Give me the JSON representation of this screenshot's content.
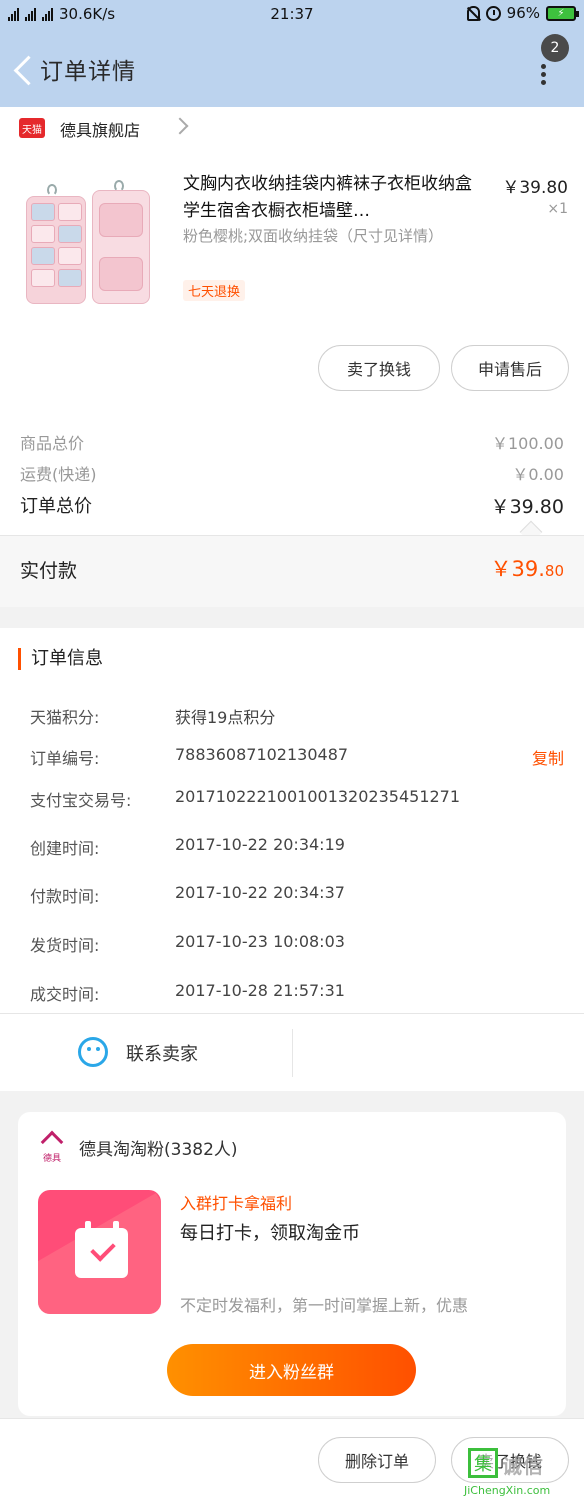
{
  "status_bar": {
    "signal_left": "2G",
    "signal_right": "4G 4G",
    "speed": "30.6K/s",
    "time": "21:37",
    "battery": "96%"
  },
  "nav": {
    "title": "订单详情",
    "message_count": "2"
  },
  "shop": {
    "badge": "天猫",
    "name": "德具旗舰店"
  },
  "product": {
    "title": "文胸内衣收纳挂袋内裤袜子衣柜收纳盒学生宿舍衣橱衣柜墙壁…",
    "price": "￥39.80",
    "qty": "×1",
    "spec": "粉色樱桃;双面收纳挂袋（尺寸见详情）",
    "tag": "七天退换"
  },
  "actions": {
    "sell": "卖了换钱",
    "after_sale": "申请售后"
  },
  "summary": {
    "goods_label": "商品总价",
    "goods_value": "￥100.00",
    "shipping_label": "运费(快递)",
    "shipping_value": "￥0.00",
    "total_label": "订单总价",
    "total_value": "￥39.80",
    "paid_label": "实付款",
    "paid_value_main": "￥39.",
    "paid_value_cents": "80"
  },
  "order_info": {
    "title": "订单信息",
    "rows": [
      {
        "label": "天猫积分:",
        "value": "获得19点积分"
      },
      {
        "label": "订单编号:",
        "value": "78836087102130487"
      },
      {
        "label": "支付宝交易号:",
        "value": "2017102221001001320235451271"
      },
      {
        "label": "创建时间:",
        "value": "2017-10-22 20:34:19"
      },
      {
        "label": "付款时间:",
        "value": "2017-10-22 20:34:37"
      },
      {
        "label": "发货时间:",
        "value": "2017-10-23 10:08:03"
      },
      {
        "label": "成交时间:",
        "value": "2017-10-28 21:57:31"
      }
    ],
    "copy_label": "复制",
    "contact_label": "联系卖家"
  },
  "fan_group": {
    "logo_text": "德具",
    "name": "德具淘淘粉(3382人)",
    "subtitle": "入群打卡拿福利",
    "headline": "每日打卡，领取淘金币",
    "description": "不定时发福利，第一时间掌握上新，优惠",
    "join_button": "进入粉丝群"
  },
  "bottom_bar": {
    "delete": "删除订单",
    "sell": "卖了换钱"
  },
  "watermark": {
    "icon_char": "集",
    "cn": "诚信",
    "en": "JiChengXin.com"
  }
}
